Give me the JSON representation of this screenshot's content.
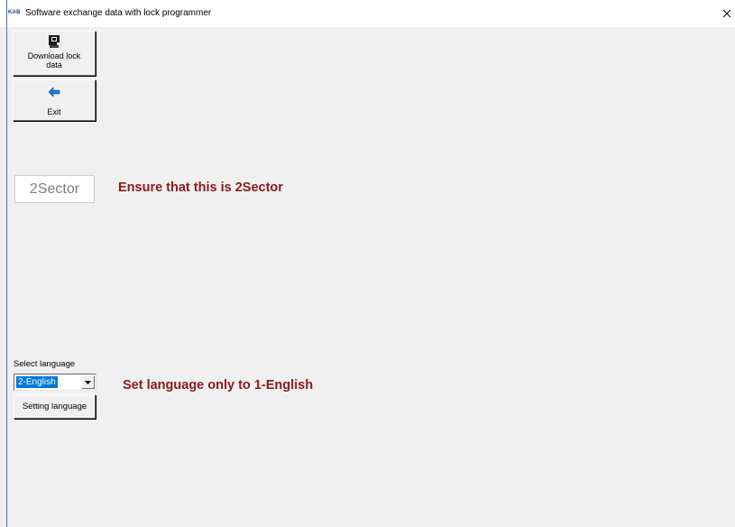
{
  "window": {
    "icon_text": "KAB",
    "title": "Software exchange data with lock programmer",
    "close_label": "×"
  },
  "toolbar": {
    "download_label": "Download lock\ndata",
    "exit_label": "Exit"
  },
  "sector": {
    "value": "2Sector",
    "note": "Ensure that this is 2Sector"
  },
  "language": {
    "label": "Select language",
    "selected": "2-English",
    "setting_button": "Setting language",
    "note": "Set language only to 1-English"
  },
  "colors": {
    "note_text": "#8b1a1a",
    "selection": "#0078d7",
    "window_bg": "#f0f0f0"
  },
  "icons": {
    "download": "download-lock-icon",
    "exit": "exit-arrow-icon",
    "dropdown": "chevron-down-icon",
    "close": "close-icon"
  }
}
